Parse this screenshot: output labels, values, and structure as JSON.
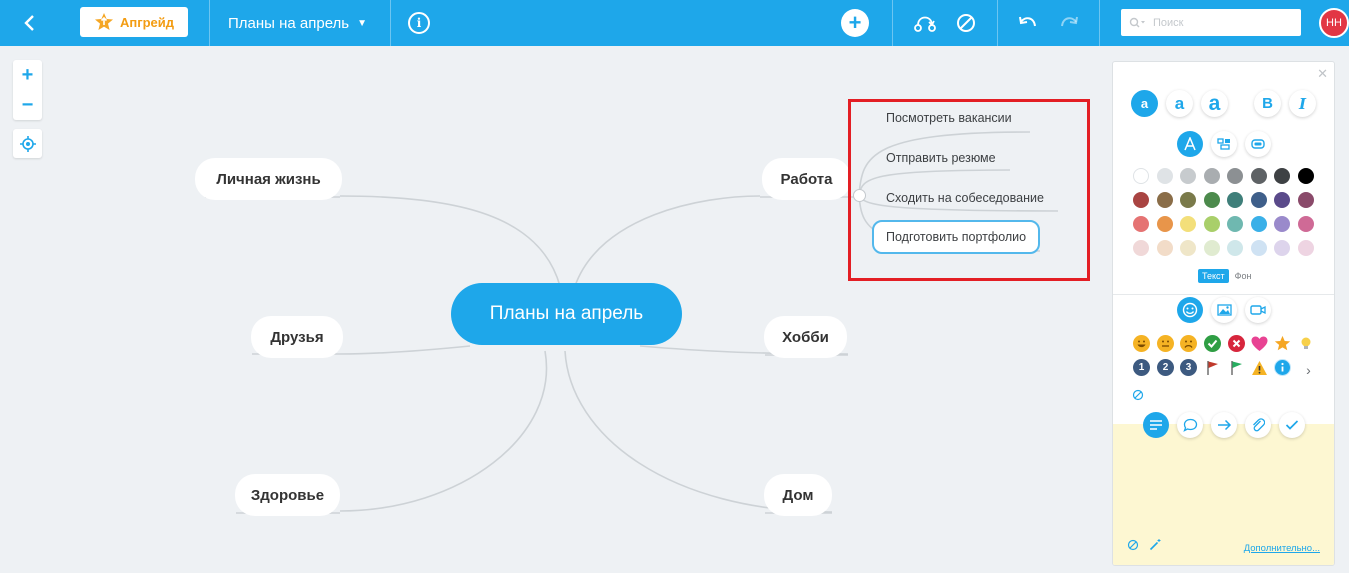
{
  "topbar": {
    "upgrade_label": "Апгрейд",
    "map_title": "Планы на апрель",
    "search_placeholder": "Поиск",
    "avatar_initials": "НН"
  },
  "map": {
    "central": "Планы на апрель",
    "branches": {
      "personal": "Личная жизнь",
      "friends": "Друзья",
      "health": "Здоровье",
      "work": "Работа",
      "hobby": "Хобби",
      "home": "Дом"
    },
    "work_children": [
      "Посмотреть вакансии",
      "Отправить резюме",
      "Сходить на собеседование",
      "Подготовить портфолио"
    ]
  },
  "panel": {
    "bold_label": "B",
    "italic_label": "I",
    "size_labels": [
      "a",
      "a",
      "a"
    ],
    "tab_text": "Текст",
    "tab_bg": "Фон",
    "number_icons": [
      "1",
      "2",
      "3"
    ],
    "more_link": "Дополнительно...",
    "palette": [
      [
        "#ffffff",
        "#dfe3e6",
        "#c7cbce",
        "#a9adb0",
        "#8c9093",
        "#5e6265",
        "#3e4144",
        "#000000"
      ],
      [
        "#a94442",
        "#8a6d48",
        "#7a7a4a",
        "#4c8a4c",
        "#3f7f7a",
        "#3f5f8a",
        "#5a4a8a",
        "#8a4a6a"
      ],
      [
        "#e57373",
        "#e8954a",
        "#f3df7a",
        "#a9cf6a",
        "#6fb8b0",
        "#3ab0e8",
        "#9a8acb",
        "#cf6a96"
      ],
      [
        "#f0d8d8",
        "#f2dcc8",
        "#efe6c8",
        "#e0ebd0",
        "#cfe7ea",
        "#cfe2f3",
        "#ddd4ec",
        "#eed4e2"
      ]
    ]
  }
}
